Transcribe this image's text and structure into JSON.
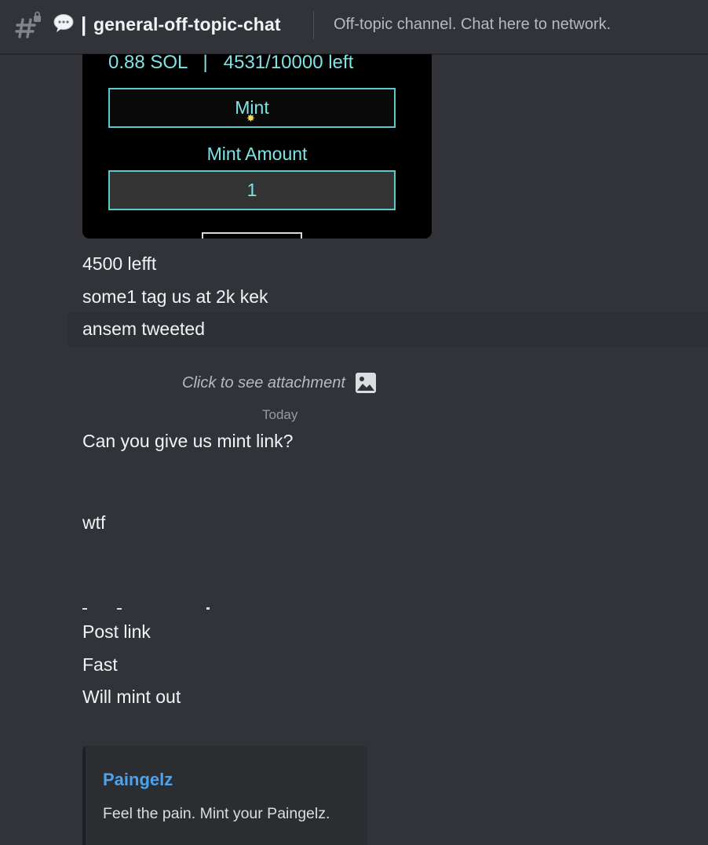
{
  "header": {
    "separator": "|",
    "channel_name": "general-off-topic-chat",
    "topic": "Off-topic channel. Chat here to network.",
    "icons": [
      "locked-hash-icon",
      "speech-bubble-icon"
    ]
  },
  "mint_card": {
    "stats": "0.88 SOL   |   4531/10000 left",
    "mint_button": "Mint",
    "amount_label": "Mint Amount",
    "amount_value": "1",
    "accent": "#7fe3e6"
  },
  "messages": [
    "4500 lefft",
    "some1 tag us at 2k kek",
    "ansem tweeted",
    "Can you give us mint link?",
    "wtf",
    "Post link",
    "Fast",
    "Will mint out"
  ],
  "attachment": {
    "label": "Click to see attachment",
    "icon": "image-icon"
  },
  "date_divider": "Today",
  "embed": {
    "title": "Paingelz",
    "description": "Feel the pain. Mint your Paingelz.",
    "title_color": "#4aa3f0"
  }
}
